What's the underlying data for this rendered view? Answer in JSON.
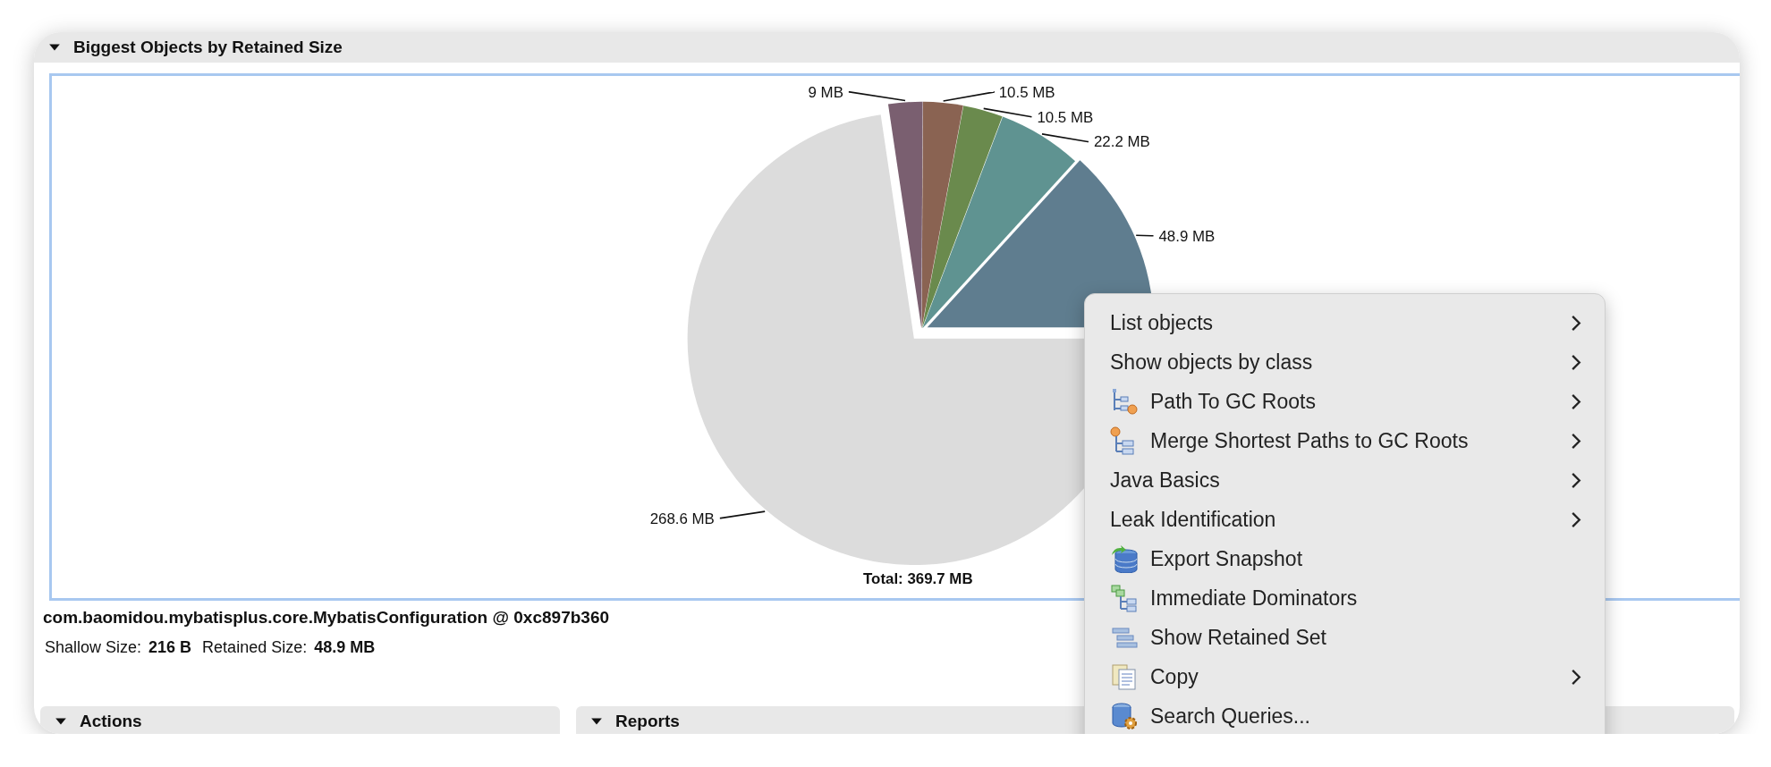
{
  "top_section": {
    "title": "Biggest Objects by Retained Size",
    "expanded": true
  },
  "chart": {
    "chart_data": {
      "type": "pie",
      "values": [
        48.9,
        22.2,
        10.5,
        10.5,
        9,
        268.6
      ],
      "data_labels": true,
      "value_labels": [
        "48.9 MB",
        "22.2 MB",
        "10.5 MB",
        "10.5 MB",
        "9 MB",
        "268.6 MB"
      ],
      "annotations": [
        "Total: 369.7 MB"
      ]
    }
  },
  "selected_object": {
    "name": "com.baomidou.mybatisplus.core.MybatisConfiguration @ 0xc897b360",
    "shallow_label": "Shallow Size:",
    "shallow_value": "216 B",
    "retained_label": "Retained Size:",
    "retained_value": "48.9 MB"
  },
  "bottom_sections": [
    {
      "title": "Actions",
      "expanded": true
    },
    {
      "title": "Reports",
      "expanded": true
    }
  ],
  "context_menu": [
    {
      "label": "List objects",
      "kind": "plain",
      "submenu": true
    },
    {
      "label": "Show objects by class",
      "kind": "plain",
      "submenu": true
    },
    {
      "label": "Path To GC Roots",
      "kind": "path",
      "submenu": true
    },
    {
      "label": "Merge Shortest Paths to GC Roots",
      "kind": "merge",
      "submenu": true
    },
    {
      "label": "Java Basics",
      "kind": "plain",
      "submenu": true
    },
    {
      "label": "Leak Identification",
      "kind": "plain",
      "submenu": true
    },
    {
      "label": "Export Snapshot",
      "kind": "export",
      "submenu": false
    },
    {
      "label": "Immediate Dominators",
      "kind": "dominators",
      "submenu": false
    },
    {
      "label": "Show Retained Set",
      "kind": "retained",
      "submenu": false
    },
    {
      "label": "Copy",
      "kind": "copy",
      "submenu": true
    },
    {
      "label": "Search Queries...",
      "kind": "query",
      "submenu": false
    }
  ]
}
